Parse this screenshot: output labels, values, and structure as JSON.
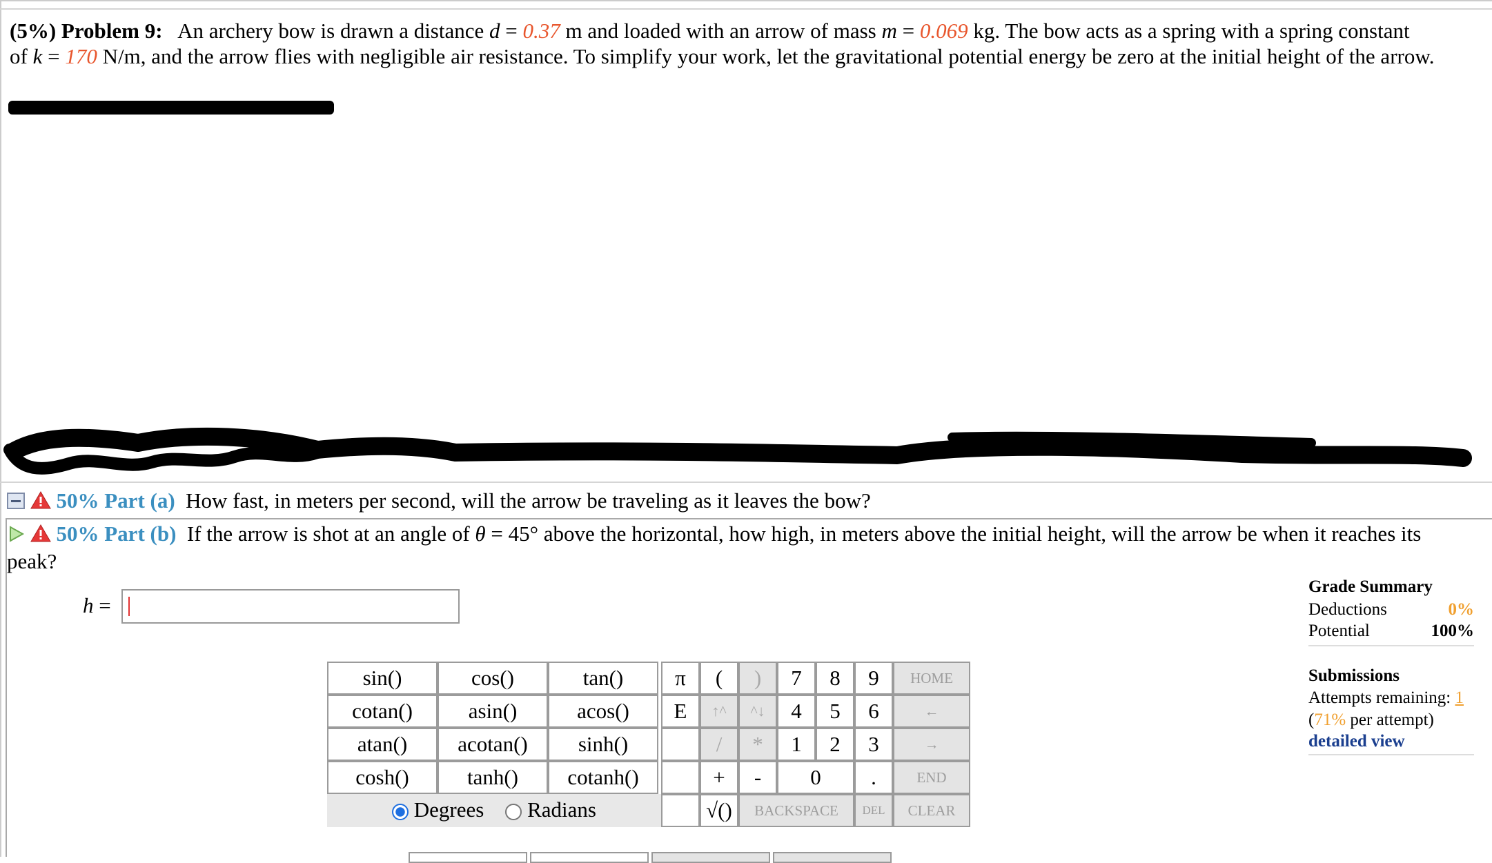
{
  "problem": {
    "prefix": "(5%) Problem 9:",
    "text1": "An archery bow is drawn a distance",
    "d_sym": "d",
    "eq": "=",
    "d_val": "0.37",
    "text2": "m and loaded with an arrow of mass",
    "m_sym": "m",
    "m_val": "0.069",
    "text3": "kg. The bow acts as a spring with a spring constant",
    "text4": "of",
    "k_sym": "k",
    "k_val": "170",
    "text5": "N/m, and the arrow flies with negligible air resistance. To simplify your work, let the gravitational potential energy be zero at the initial height of the arrow."
  },
  "parts": [
    {
      "label": "50% Part (a)",
      "question": "How fast, in meters per second, will the arrow be traveling as it leaves the bow?"
    },
    {
      "label": "50% Part (b)",
      "question_line1": "If the arrow is shot at an angle of",
      "theta": "θ",
      "eq": "=",
      "angle": "45°",
      "question_rest": "above the horizontal, how high, in meters above the initial height, will the arrow be when it reaches its",
      "question_line2": "peak?"
    }
  ],
  "answer": {
    "var": "h",
    "eq": "=",
    "value": ""
  },
  "calculator": {
    "functions": [
      [
        "sin()",
        "cos()",
        "tan()"
      ],
      [
        "cotan()",
        "asin()",
        "acos()"
      ],
      [
        "atan()",
        "acotan()",
        "sinh()"
      ],
      [
        "cosh()",
        "tanh()",
        "cotanh()"
      ]
    ],
    "pi": "π",
    "e": "E",
    "open_paren": "(",
    "close_paren": ")",
    "up_arrows": "↑^",
    "down_arrows": "^↓",
    "divide": "/",
    "multiply": "*",
    "plus": "+",
    "minus": "-",
    "sqrt": "√()",
    "digits": [
      "7",
      "8",
      "9",
      "4",
      "5",
      "6",
      "1",
      "2",
      "3",
      "0",
      "."
    ],
    "home": "HOME",
    "back_arrow": "←",
    "fwd_arrow": "→",
    "end": "END",
    "backspace": "BACKSPACE",
    "del": "DEL",
    "clear": "CLEAR",
    "mode_degrees": "Degrees",
    "mode_radians": "Radians",
    "mode_selected": "Degrees"
  },
  "summary": {
    "title": "Grade Summary",
    "deductions_label": "Deductions",
    "deductions_value": "0%",
    "potential_label": "Potential",
    "potential_value": "100%",
    "submissions_title": "Submissions",
    "attempts_label": "Attempts remaining:",
    "attempts_value": "1",
    "per_attempt_open": "(",
    "per_attempt_pct": "71%",
    "per_attempt_rest": "per attempt)",
    "detailed_link": "detailed view"
  },
  "colors": {
    "value": "#e8562d",
    "part_label": "#3b8fc0",
    "link": "#1b3f8f",
    "summary_accent": "#f0a030"
  }
}
